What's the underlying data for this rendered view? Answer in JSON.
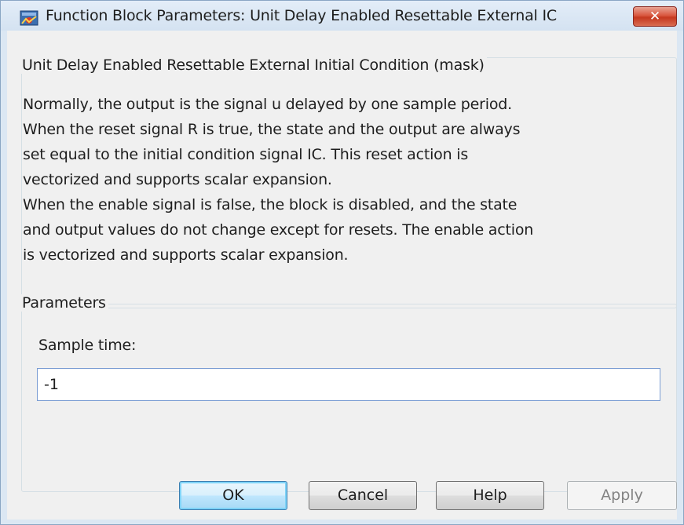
{
  "window": {
    "title": "Function Block Parameters: Unit Delay Enabled Resettable External IC",
    "close_label": "✕"
  },
  "description_group": {
    "legend": "Unit Delay Enabled Resettable External Initial Condition (mask)",
    "lines": [
      "Normally, the output is the signal u delayed by one sample period.",
      "When the reset signal R is true, the state and the output are always",
      "set equal to the initial condition signal IC.  This reset action is",
      "vectorized and supports scalar expansion.",
      "When the enable signal is false, the block is disabled, and the state",
      "and output values do not change except for resets.  The enable action",
      "is vectorized and supports scalar expansion."
    ]
  },
  "parameters_group": {
    "legend": "Parameters",
    "sample_time_label": "Sample time:",
    "sample_time_value": "-1"
  },
  "buttons": {
    "ok": "OK",
    "cancel": "Cancel",
    "help": "Help",
    "apply": "Apply"
  },
  "icons": {
    "app": "simulink-block-icon",
    "close": "close-icon"
  },
  "colors": {
    "title_bar": "#dbe7f3",
    "close_button": "#d9573f",
    "dialog_background": "#f0f0f0",
    "ok_focus": "#7fd3f7"
  }
}
